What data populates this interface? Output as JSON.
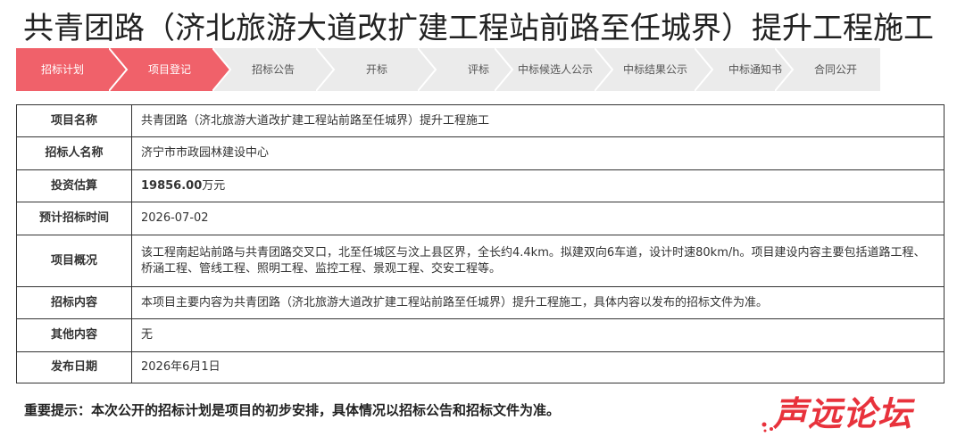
{
  "page": {
    "title": "共青团路（济北旅游大道改扩建工程站前路至任城界）提升工程施工"
  },
  "colors": {
    "active_step": "#f0616a",
    "inactive_step": "#ebebeb",
    "inactive_text": "#555555",
    "active_text": "#ffffff",
    "watermark": "#e8323c"
  },
  "steps": [
    {
      "label": "招标计划",
      "active": true
    },
    {
      "label": "项目登记",
      "active": true
    },
    {
      "label": "招标公告",
      "active": false
    },
    {
      "label": "开标",
      "active": false
    },
    {
      "label": "评标",
      "active": false
    },
    {
      "label": "中标候选人公示",
      "active": false
    },
    {
      "label": "中标结果公示",
      "active": false
    },
    {
      "label": "中标通知书",
      "active": false
    },
    {
      "label": "合同公开",
      "active": false
    }
  ],
  "rows": [
    {
      "label": "项目名称",
      "value": "共青团路（济北旅游大道改扩建工程站前路至任城界）提升工程施工"
    },
    {
      "label": "招标人名称",
      "value": "济宁市市政园林建设中心"
    },
    {
      "label": "投资估算",
      "amount": "19856.00",
      "unit": "万元"
    },
    {
      "label": "预计招标时间",
      "value": "2026-07-02"
    },
    {
      "label": "项目概况",
      "value": "该工程南起站前路与共青团路交叉口，北至任城区与汶上县区界，全长约4.4km。拟建双向6车道，设计时速80km/h。项目建设内容主要包括道路工程、桥涵工程、管线工程、照明工程、监控工程、景观工程、交安工程等。"
    },
    {
      "label": "招标内容",
      "value": "本项目主要内容为共青团路（济北旅游大道改扩建工程站前路至任城界）提升工程施工，具体内容以发布的招标文件为准。"
    },
    {
      "label": "其他内容",
      "value": "无"
    },
    {
      "label": "发布日期",
      "value": "2026年6月1日"
    }
  ],
  "note": "重要提示：本次公开的招标计划是项目的初步安排，具体情况以招标公告和招标文件为准。",
  "watermark": "声远论坛"
}
